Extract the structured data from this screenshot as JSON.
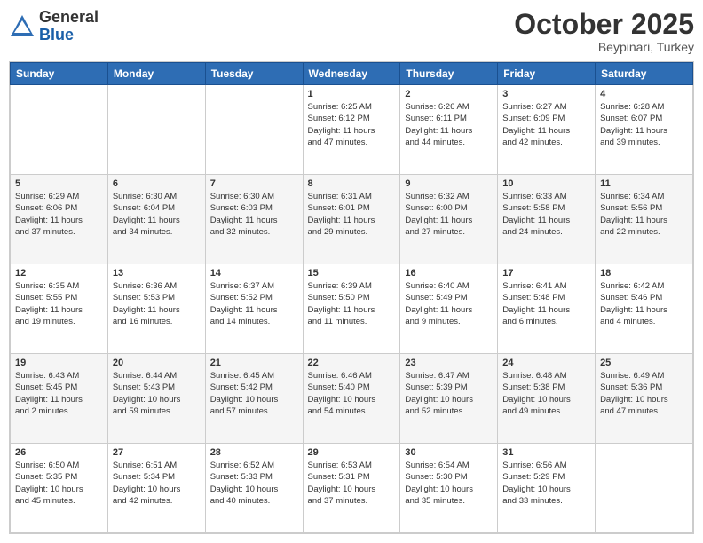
{
  "logo": {
    "general": "General",
    "blue": "Blue"
  },
  "header": {
    "month": "October 2025",
    "location": "Beypinari, Turkey"
  },
  "weekdays": [
    "Sunday",
    "Monday",
    "Tuesday",
    "Wednesday",
    "Thursday",
    "Friday",
    "Saturday"
  ],
  "weeks": [
    [
      {
        "day": "",
        "info": ""
      },
      {
        "day": "",
        "info": ""
      },
      {
        "day": "",
        "info": ""
      },
      {
        "day": "1",
        "info": "Sunrise: 6:25 AM\nSunset: 6:12 PM\nDaylight: 11 hours\nand 47 minutes."
      },
      {
        "day": "2",
        "info": "Sunrise: 6:26 AM\nSunset: 6:11 PM\nDaylight: 11 hours\nand 44 minutes."
      },
      {
        "day": "3",
        "info": "Sunrise: 6:27 AM\nSunset: 6:09 PM\nDaylight: 11 hours\nand 42 minutes."
      },
      {
        "day": "4",
        "info": "Sunrise: 6:28 AM\nSunset: 6:07 PM\nDaylight: 11 hours\nand 39 minutes."
      }
    ],
    [
      {
        "day": "5",
        "info": "Sunrise: 6:29 AM\nSunset: 6:06 PM\nDaylight: 11 hours\nand 37 minutes."
      },
      {
        "day": "6",
        "info": "Sunrise: 6:30 AM\nSunset: 6:04 PM\nDaylight: 11 hours\nand 34 minutes."
      },
      {
        "day": "7",
        "info": "Sunrise: 6:30 AM\nSunset: 6:03 PM\nDaylight: 11 hours\nand 32 minutes."
      },
      {
        "day": "8",
        "info": "Sunrise: 6:31 AM\nSunset: 6:01 PM\nDaylight: 11 hours\nand 29 minutes."
      },
      {
        "day": "9",
        "info": "Sunrise: 6:32 AM\nSunset: 6:00 PM\nDaylight: 11 hours\nand 27 minutes."
      },
      {
        "day": "10",
        "info": "Sunrise: 6:33 AM\nSunset: 5:58 PM\nDaylight: 11 hours\nand 24 minutes."
      },
      {
        "day": "11",
        "info": "Sunrise: 6:34 AM\nSunset: 5:56 PM\nDaylight: 11 hours\nand 22 minutes."
      }
    ],
    [
      {
        "day": "12",
        "info": "Sunrise: 6:35 AM\nSunset: 5:55 PM\nDaylight: 11 hours\nand 19 minutes."
      },
      {
        "day": "13",
        "info": "Sunrise: 6:36 AM\nSunset: 5:53 PM\nDaylight: 11 hours\nand 16 minutes."
      },
      {
        "day": "14",
        "info": "Sunrise: 6:37 AM\nSunset: 5:52 PM\nDaylight: 11 hours\nand 14 minutes."
      },
      {
        "day": "15",
        "info": "Sunrise: 6:39 AM\nSunset: 5:50 PM\nDaylight: 11 hours\nand 11 minutes."
      },
      {
        "day": "16",
        "info": "Sunrise: 6:40 AM\nSunset: 5:49 PM\nDaylight: 11 hours\nand 9 minutes."
      },
      {
        "day": "17",
        "info": "Sunrise: 6:41 AM\nSunset: 5:48 PM\nDaylight: 11 hours\nand 6 minutes."
      },
      {
        "day": "18",
        "info": "Sunrise: 6:42 AM\nSunset: 5:46 PM\nDaylight: 11 hours\nand 4 minutes."
      }
    ],
    [
      {
        "day": "19",
        "info": "Sunrise: 6:43 AM\nSunset: 5:45 PM\nDaylight: 11 hours\nand 2 minutes."
      },
      {
        "day": "20",
        "info": "Sunrise: 6:44 AM\nSunset: 5:43 PM\nDaylight: 10 hours\nand 59 minutes."
      },
      {
        "day": "21",
        "info": "Sunrise: 6:45 AM\nSunset: 5:42 PM\nDaylight: 10 hours\nand 57 minutes."
      },
      {
        "day": "22",
        "info": "Sunrise: 6:46 AM\nSunset: 5:40 PM\nDaylight: 10 hours\nand 54 minutes."
      },
      {
        "day": "23",
        "info": "Sunrise: 6:47 AM\nSunset: 5:39 PM\nDaylight: 10 hours\nand 52 minutes."
      },
      {
        "day": "24",
        "info": "Sunrise: 6:48 AM\nSunset: 5:38 PM\nDaylight: 10 hours\nand 49 minutes."
      },
      {
        "day": "25",
        "info": "Sunrise: 6:49 AM\nSunset: 5:36 PM\nDaylight: 10 hours\nand 47 minutes."
      }
    ],
    [
      {
        "day": "26",
        "info": "Sunrise: 6:50 AM\nSunset: 5:35 PM\nDaylight: 10 hours\nand 45 minutes."
      },
      {
        "day": "27",
        "info": "Sunrise: 6:51 AM\nSunset: 5:34 PM\nDaylight: 10 hours\nand 42 minutes."
      },
      {
        "day": "28",
        "info": "Sunrise: 6:52 AM\nSunset: 5:33 PM\nDaylight: 10 hours\nand 40 minutes."
      },
      {
        "day": "29",
        "info": "Sunrise: 6:53 AM\nSunset: 5:31 PM\nDaylight: 10 hours\nand 37 minutes."
      },
      {
        "day": "30",
        "info": "Sunrise: 6:54 AM\nSunset: 5:30 PM\nDaylight: 10 hours\nand 35 minutes."
      },
      {
        "day": "31",
        "info": "Sunrise: 6:56 AM\nSunset: 5:29 PM\nDaylight: 10 hours\nand 33 minutes."
      },
      {
        "day": "",
        "info": ""
      }
    ]
  ]
}
